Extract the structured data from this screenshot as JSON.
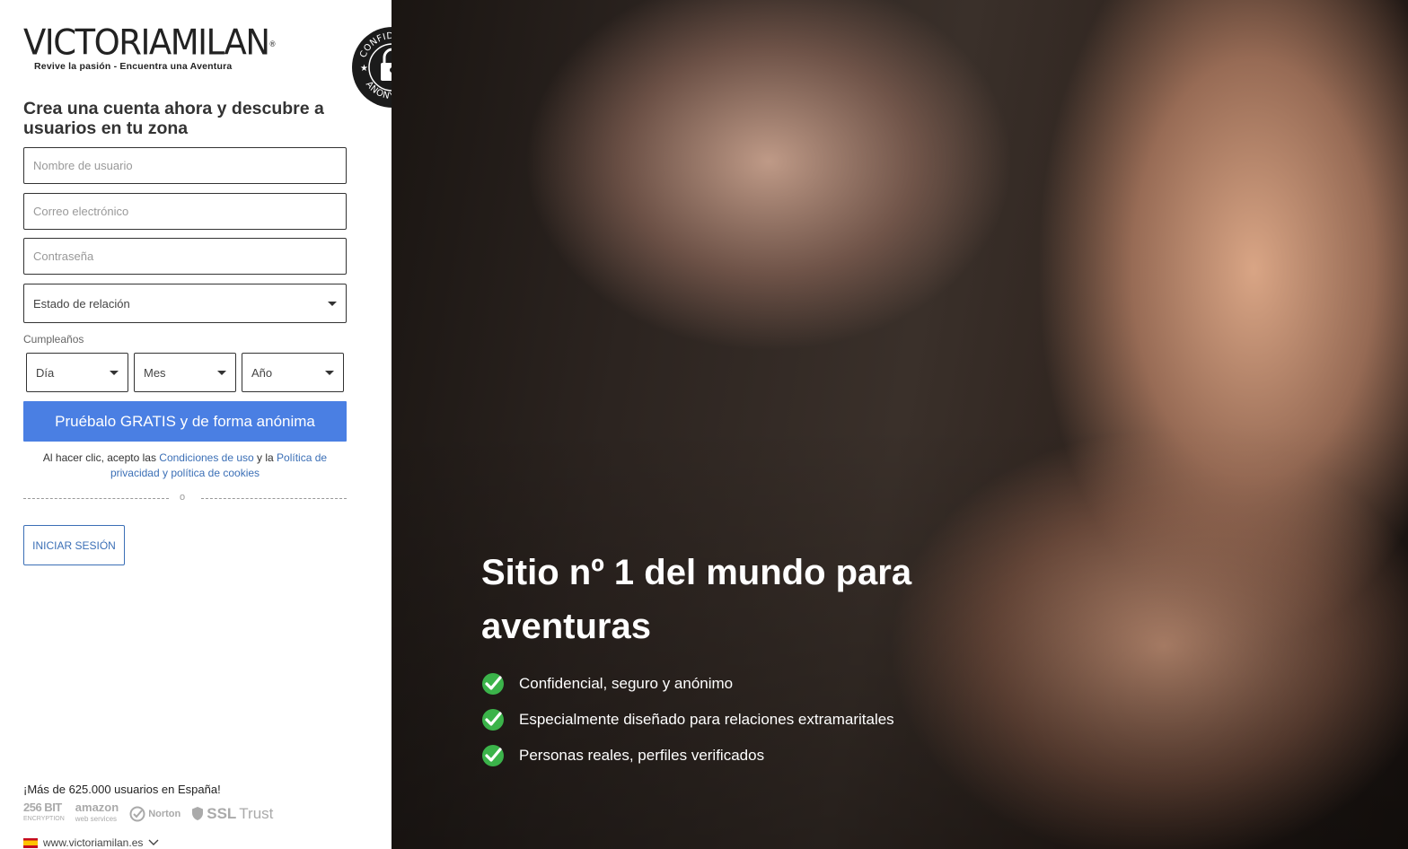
{
  "logo": {
    "brand_victoria": "VICTORIA",
    "brand_milan": "MILAN",
    "registered": "®",
    "tagline": "Revive la pasión - Encuentra una Aventura"
  },
  "badge": {
    "text_top": "CONFIDENTIAL",
    "text_bottom": "ANONYMOUS"
  },
  "signup": {
    "heading": "Crea una cuenta ahora y descubre a usuarios en tu zona",
    "username_placeholder": "Nombre de usuario",
    "email_placeholder": "Correo electrónico",
    "password_placeholder": "Contraseña",
    "relationship_label": "Estado de relación",
    "birthday_label": "Cumpleaños",
    "day_label": "Día",
    "month_label": "Mes",
    "year_label": "Año",
    "cta_label": "Pruébalo GRATIS y de forma anónima",
    "legal_prefix": "Al hacer clic, acepto las ",
    "legal_terms": "Condiciones de uso",
    "legal_and": " y la ",
    "legal_privacy": "Política de privacidad y política de cookies",
    "divider_text": "o",
    "login_label": "INICIAR SESIÓN"
  },
  "footer": {
    "users_count": "¡Más de 625.000 usuarios en España!",
    "trust_256": "256 BIT",
    "trust_256_sub": "ENCRYPTION",
    "trust_amazon": "amazon",
    "trust_amazon_sub": "web services",
    "trust_norton": "Norton",
    "trust_ssl_a": "SSL",
    "trust_ssl_b": "Trust",
    "site_url": "www.victoriamilan.es"
  },
  "hero": {
    "title": "Sitio nº 1 del mundo para aventuras",
    "features": [
      "Confidencial, seguro y anónimo",
      "Especialmente diseñado para relaciones extramaritales",
      "Personas reales, perfiles verificados"
    ]
  },
  "colors": {
    "accent": "#4a7fe3",
    "link": "#3b6fb6",
    "check_green": "#3bb34a"
  }
}
